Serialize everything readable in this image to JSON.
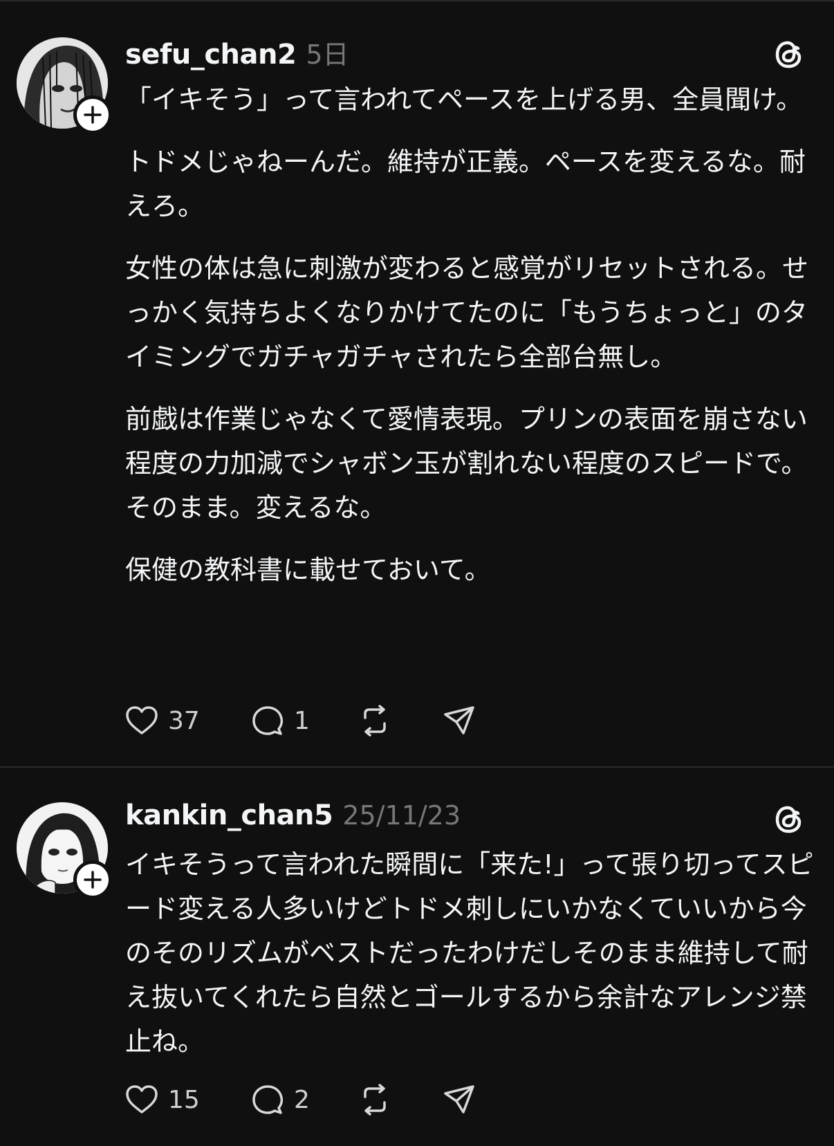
{
  "colors": {
    "background": "#101010",
    "text_primary": "#f3f5f7",
    "text_secondary": "#777777",
    "divider": "#2a2a2a"
  },
  "posts": [
    {
      "username": "sefu_chan2",
      "timestamp": "5日",
      "paragraphs": [
        "「イキそう」って言われてペースを上げる男、全員聞け。",
        "トドメじゃねーんだ。維持が正義。ペースを変えるな。耐えろ。",
        "女性の体は急に刺激が変わると感覚がリセットされる。せっかく気持ちよくなりかけてたのに「もうちょっと」のタイミングでガチャガチャされたら全部台無し。",
        "前戯は作業じゃなくて愛情表現。プリンの表面を崩さない程度の力加減でシャボン玉が割れない程度のスピードで。そのまま。変えるな。",
        "保健の教科書に載せておいて。"
      ],
      "like_count": "37",
      "reply_count": "1",
      "icons": [
        "avatar",
        "plus-icon",
        "threads-icon",
        "heart-icon",
        "comment-icon",
        "repost-icon",
        "share-icon"
      ]
    },
    {
      "username": "kankin_chan5",
      "timestamp": "25/11/23",
      "paragraphs": [
        "イキそうって言われた瞬間に「来た!」って張り切ってスピード変える人多いけどトドメ刺しにいかなくていいから今のそのリズムがベストだったわけだしそのまま維持して耐え抜いてくれたら自然とゴールするから余計なアレンジ禁止ね。"
      ],
      "like_count": "15",
      "reply_count": "2",
      "icons": [
        "avatar",
        "plus-icon",
        "threads-icon",
        "heart-icon",
        "comment-icon",
        "repost-icon",
        "share-icon"
      ]
    }
  ]
}
